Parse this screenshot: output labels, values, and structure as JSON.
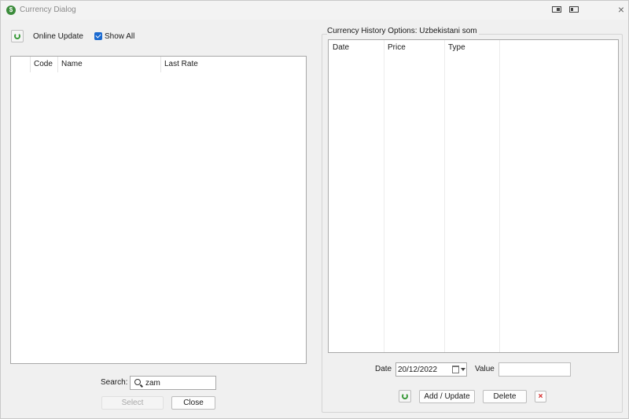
{
  "window": {
    "title": "Currency Dialog",
    "app_icon_glyph": "$"
  },
  "left": {
    "online_update_label": "Online Update",
    "show_all_label": "Show All",
    "show_all_checked": true,
    "columns": [
      "",
      "Code",
      "Name",
      "Last Rate"
    ],
    "rows": [],
    "search_label": "Search:",
    "search_value": "zam",
    "select_label": "Select",
    "close_label": "Close"
  },
  "right": {
    "group_title": "Currency History Options: Uzbekistani som",
    "columns": [
      "Date",
      "Price",
      "Type"
    ],
    "rows": [],
    "date_label": "Date",
    "date_value": "20/12/2022",
    "value_label": "Value",
    "value_value": "",
    "add_update_label": "Add / Update",
    "delete_label": "Delete",
    "clear_glyph": "×"
  },
  "colors": {
    "accent": "#1b6ad0",
    "refresh_green": "#3a9a3a",
    "delete_red": "#d32020"
  }
}
